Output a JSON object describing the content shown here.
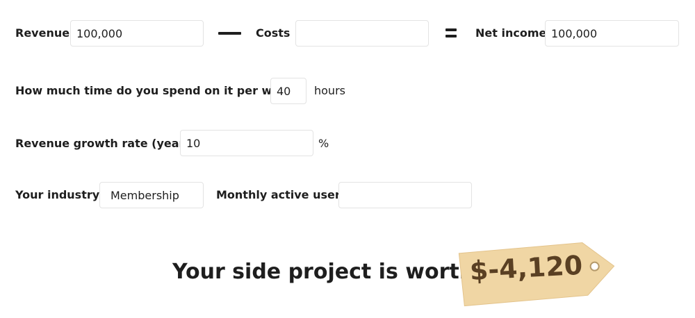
{
  "row_income": {
    "revenue_label": "Revenue",
    "revenue_value": "100,000",
    "costs_label": "Costs",
    "costs_value": "",
    "net_income_label": "Net income",
    "net_income_value": "100,000"
  },
  "row_time": {
    "label": "How much time do you spend on it per week?",
    "value": "40",
    "unit": "hours"
  },
  "row_growth": {
    "label": "Revenue growth rate (yearly)",
    "value": "10",
    "unit": "%"
  },
  "row_industry": {
    "industry_label": "Your industry",
    "industry_value": "Membership",
    "users_label": "Monthly active users",
    "users_value": ""
  },
  "result": {
    "headline": "Your side project is worth:",
    "price": "$-4,120"
  },
  "icons": {
    "operators": [
      "minus-icon",
      "equals-icon"
    ],
    "tag": "price-tag-icon"
  },
  "colors": {
    "text": "#1e1e1e",
    "tag_fill": "#f0d6a4",
    "tag_text": "#5a4023",
    "field_border": "#e3e3e3"
  }
}
